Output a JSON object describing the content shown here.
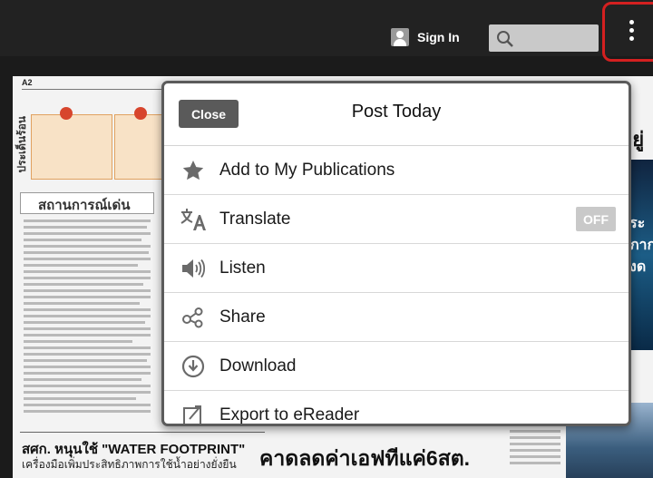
{
  "toolbar": {
    "signin_label": "Sign In"
  },
  "menu": {
    "close_label": "Close",
    "title": "Post Today",
    "items": [
      {
        "label": "Add to My Publications",
        "icon": "star-icon"
      },
      {
        "label": "Translate",
        "icon": "translate-icon",
        "toggle": "OFF"
      },
      {
        "label": "Listen",
        "icon": "speaker-icon"
      },
      {
        "label": "Share",
        "icon": "share-icon"
      },
      {
        "label": "Download",
        "icon": "download-icon"
      },
      {
        "label": "Export to eReader",
        "icon": "export-icon"
      }
    ]
  },
  "newspaper": {
    "page_marker": "A2",
    "box_heading": "สถานการณ์เด่น",
    "side_label": "ประเด็นร้อน",
    "headline_left": "สศก. หนุนใช้ \"WATER FOOTPRINT\"",
    "headline_right": "คาดลดค่าเอฟทีแค่6สต.",
    "subline_left": "เครื่องมือเพิ่มประสิทธิภาพการใช้น้ำอย่างยั่งยืน",
    "right_fragment": "อยู่",
    "blue_fragments": [
      "ระ",
      "ภาก",
      "งด"
    ]
  }
}
